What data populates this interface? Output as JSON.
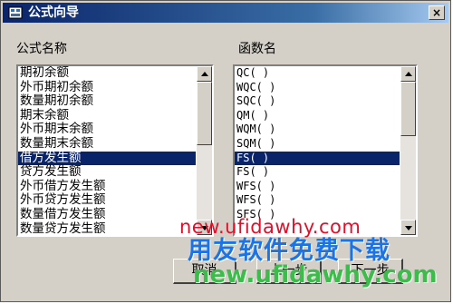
{
  "window": {
    "title": "公式向导",
    "close_label": "×"
  },
  "left_panel": {
    "label": "公式名称",
    "items": [
      "期初余额",
      "外币期初余额",
      "数量期初余额",
      "期末余额",
      "外币期末余额",
      "数量期末余额",
      "借方发生额",
      "贷方发生额",
      "外币借方发生额",
      "外币贷方发生额",
      "数量借方发生额",
      "数量贷方发生额"
    ],
    "selected_index": 6
  },
  "right_panel": {
    "label": "函数名",
    "items": [
      "QC( )",
      "WQC( )",
      "SQC( )",
      "QM( )",
      "WQM( )",
      "SQM( )",
      "FS( )",
      "FS( )",
      "WFS( )",
      "WFS( )",
      "SFS( )"
    ],
    "selected_index": 6
  },
  "buttons": {
    "cancel": "取消",
    "prev": "上一步",
    "next": "下一步"
  },
  "watermark": {
    "line1": "new.ufidawhy.com",
    "line2": "用友软件免费下载",
    "line3": "new.ufidawhy.com"
  }
}
